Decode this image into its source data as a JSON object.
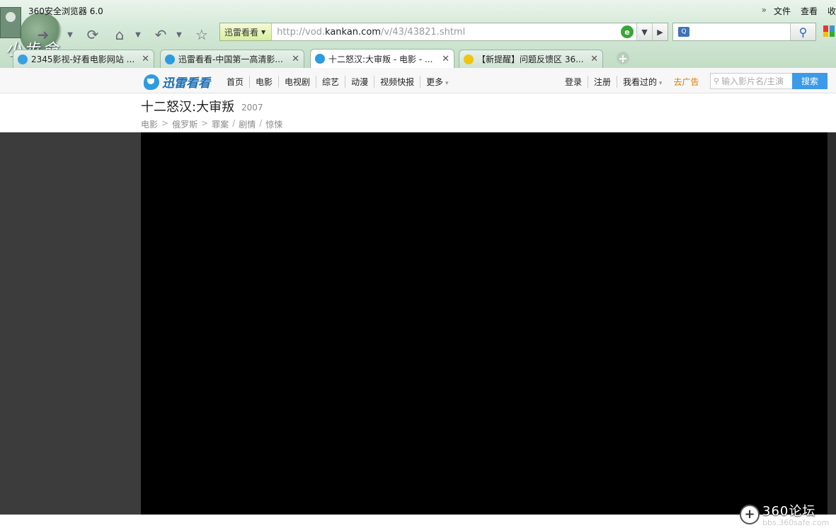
{
  "browser": {
    "title": "360安全浏览器 6.0",
    "menu": [
      "文件",
      "查看",
      "收"
    ],
    "skin_text": "小步命",
    "address": {
      "tag": "迅雷看看",
      "url_prefix": "http://vod.",
      "url_domain": "kankan.com",
      "url_path": "/v/43/43821.shtml"
    },
    "search_value": "",
    "tabs": [
      {
        "label": "2345影视-好看电影网站 ...",
        "icon_color": "#3aa0e0",
        "active": false
      },
      {
        "label": "迅雷看看-中国第一高清影...",
        "icon_color": "#2d9be0",
        "active": false
      },
      {
        "label": "十二怒汉:大审叛 - 电影 - ...",
        "icon_color": "#2d9be0",
        "active": true
      },
      {
        "label": "【新提醒】问题反馈区 36...",
        "icon_color": "#f1c40f",
        "active": false
      }
    ]
  },
  "site": {
    "logo_text": "迅雷看看",
    "nav": [
      "首页",
      "电影",
      "电视剧",
      "综艺",
      "动漫",
      "视频快报",
      "更多"
    ],
    "user": {
      "login": "登录",
      "register": "注册",
      "history": "我看过的",
      "ad": "去广告"
    },
    "search_placeholder": "输入影片名/主演",
    "search_button": "搜索"
  },
  "movie": {
    "title": "十二怒汉:大审叛",
    "year": "2007",
    "breadcrumb": [
      "电影",
      "俄罗斯",
      "罪案",
      "剧情",
      "惊悚"
    ]
  },
  "watermark": {
    "title": "360论坛",
    "url": "bbs.360safe.com"
  },
  "colors": {
    "accent": "#3c9be8",
    "ad": "#e07b00",
    "chrome": "#c2ddc5"
  }
}
